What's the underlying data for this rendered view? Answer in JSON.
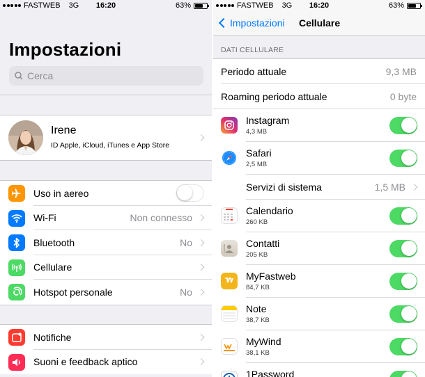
{
  "colors": {
    "ios_blue": "#007aff",
    "toggle_on": "#4cd964",
    "group_bg": "#efeff4"
  },
  "left": {
    "status": {
      "carrier": "FASTWEB",
      "network": "3G",
      "time": "16:20",
      "battery": "63%",
      "battery_level": 0.63
    },
    "title": "Impostazioni",
    "search": {
      "placeholder": "Cerca",
      "icon": "search-icon"
    },
    "profile": {
      "name": "Irene",
      "subtitle": "ID Apple, iCloud, iTunes e App Store"
    },
    "group1": [
      {
        "label": "Uso in aereo",
        "icon": "airplane-icon",
        "icon_color": "#ff9500",
        "toggle": false
      },
      {
        "label": "Wi-Fi",
        "value": "Non connesso",
        "icon": "wifi-icon",
        "icon_color": "#007aff"
      },
      {
        "label": "Bluetooth",
        "value": "No",
        "icon": "bluetooth-icon",
        "icon_color": "#007aff"
      },
      {
        "label": "Cellulare",
        "value": "",
        "icon": "antenna-icon",
        "icon_color": "#4cd964"
      },
      {
        "label": "Hotspot personale",
        "value": "No",
        "icon": "hotspot-icon",
        "icon_color": "#4cd964"
      }
    ],
    "group2": [
      {
        "label": "Notifiche",
        "icon": "notifications-icon",
        "icon_color": "#ff3b30"
      },
      {
        "label": "Suoni e feedback aptico",
        "icon": "speaker-icon",
        "icon_color": "#ff2d55"
      }
    ]
  },
  "right": {
    "status": {
      "carrier": "FASTWEB",
      "network": "3G",
      "time": "16:20",
      "battery": "63%",
      "battery_level": 0.63
    },
    "nav": {
      "back_label": "Impostazioni",
      "title": "Cellulare"
    },
    "section_header": "DATI CELLULARE",
    "usage": [
      {
        "label": "Periodo attuale",
        "value": "9,3 MB"
      },
      {
        "label": "Roaming periodo attuale",
        "value": "0 byte"
      }
    ],
    "apps": [
      {
        "name": "Instagram",
        "size": "4,3 MB",
        "icon": "instagram-icon",
        "enabled": true
      },
      {
        "name": "Safari",
        "size": "2,5 MB",
        "icon": "safari-icon",
        "enabled": true
      }
    ],
    "system_services": {
      "label": "Servizi di sistema",
      "value": "1,5 MB"
    },
    "apps2": [
      {
        "name": "Calendario",
        "size": "260 KB",
        "icon": "calendar-icon",
        "enabled": true
      },
      {
        "name": "Contatti",
        "size": "205 KB",
        "icon": "contacts-icon",
        "enabled": true
      },
      {
        "name": "MyFastweb",
        "size": "84,7 KB",
        "icon": "myfastweb-icon",
        "enabled": true
      },
      {
        "name": "Note",
        "size": "38,7 KB",
        "icon": "notes-icon",
        "enabled": true
      },
      {
        "name": "MyWind",
        "size": "38,1 KB",
        "icon": "mywind-icon",
        "enabled": true
      },
      {
        "name": "1Password",
        "size": "",
        "icon": "1password-icon",
        "enabled": true
      }
    ]
  }
}
